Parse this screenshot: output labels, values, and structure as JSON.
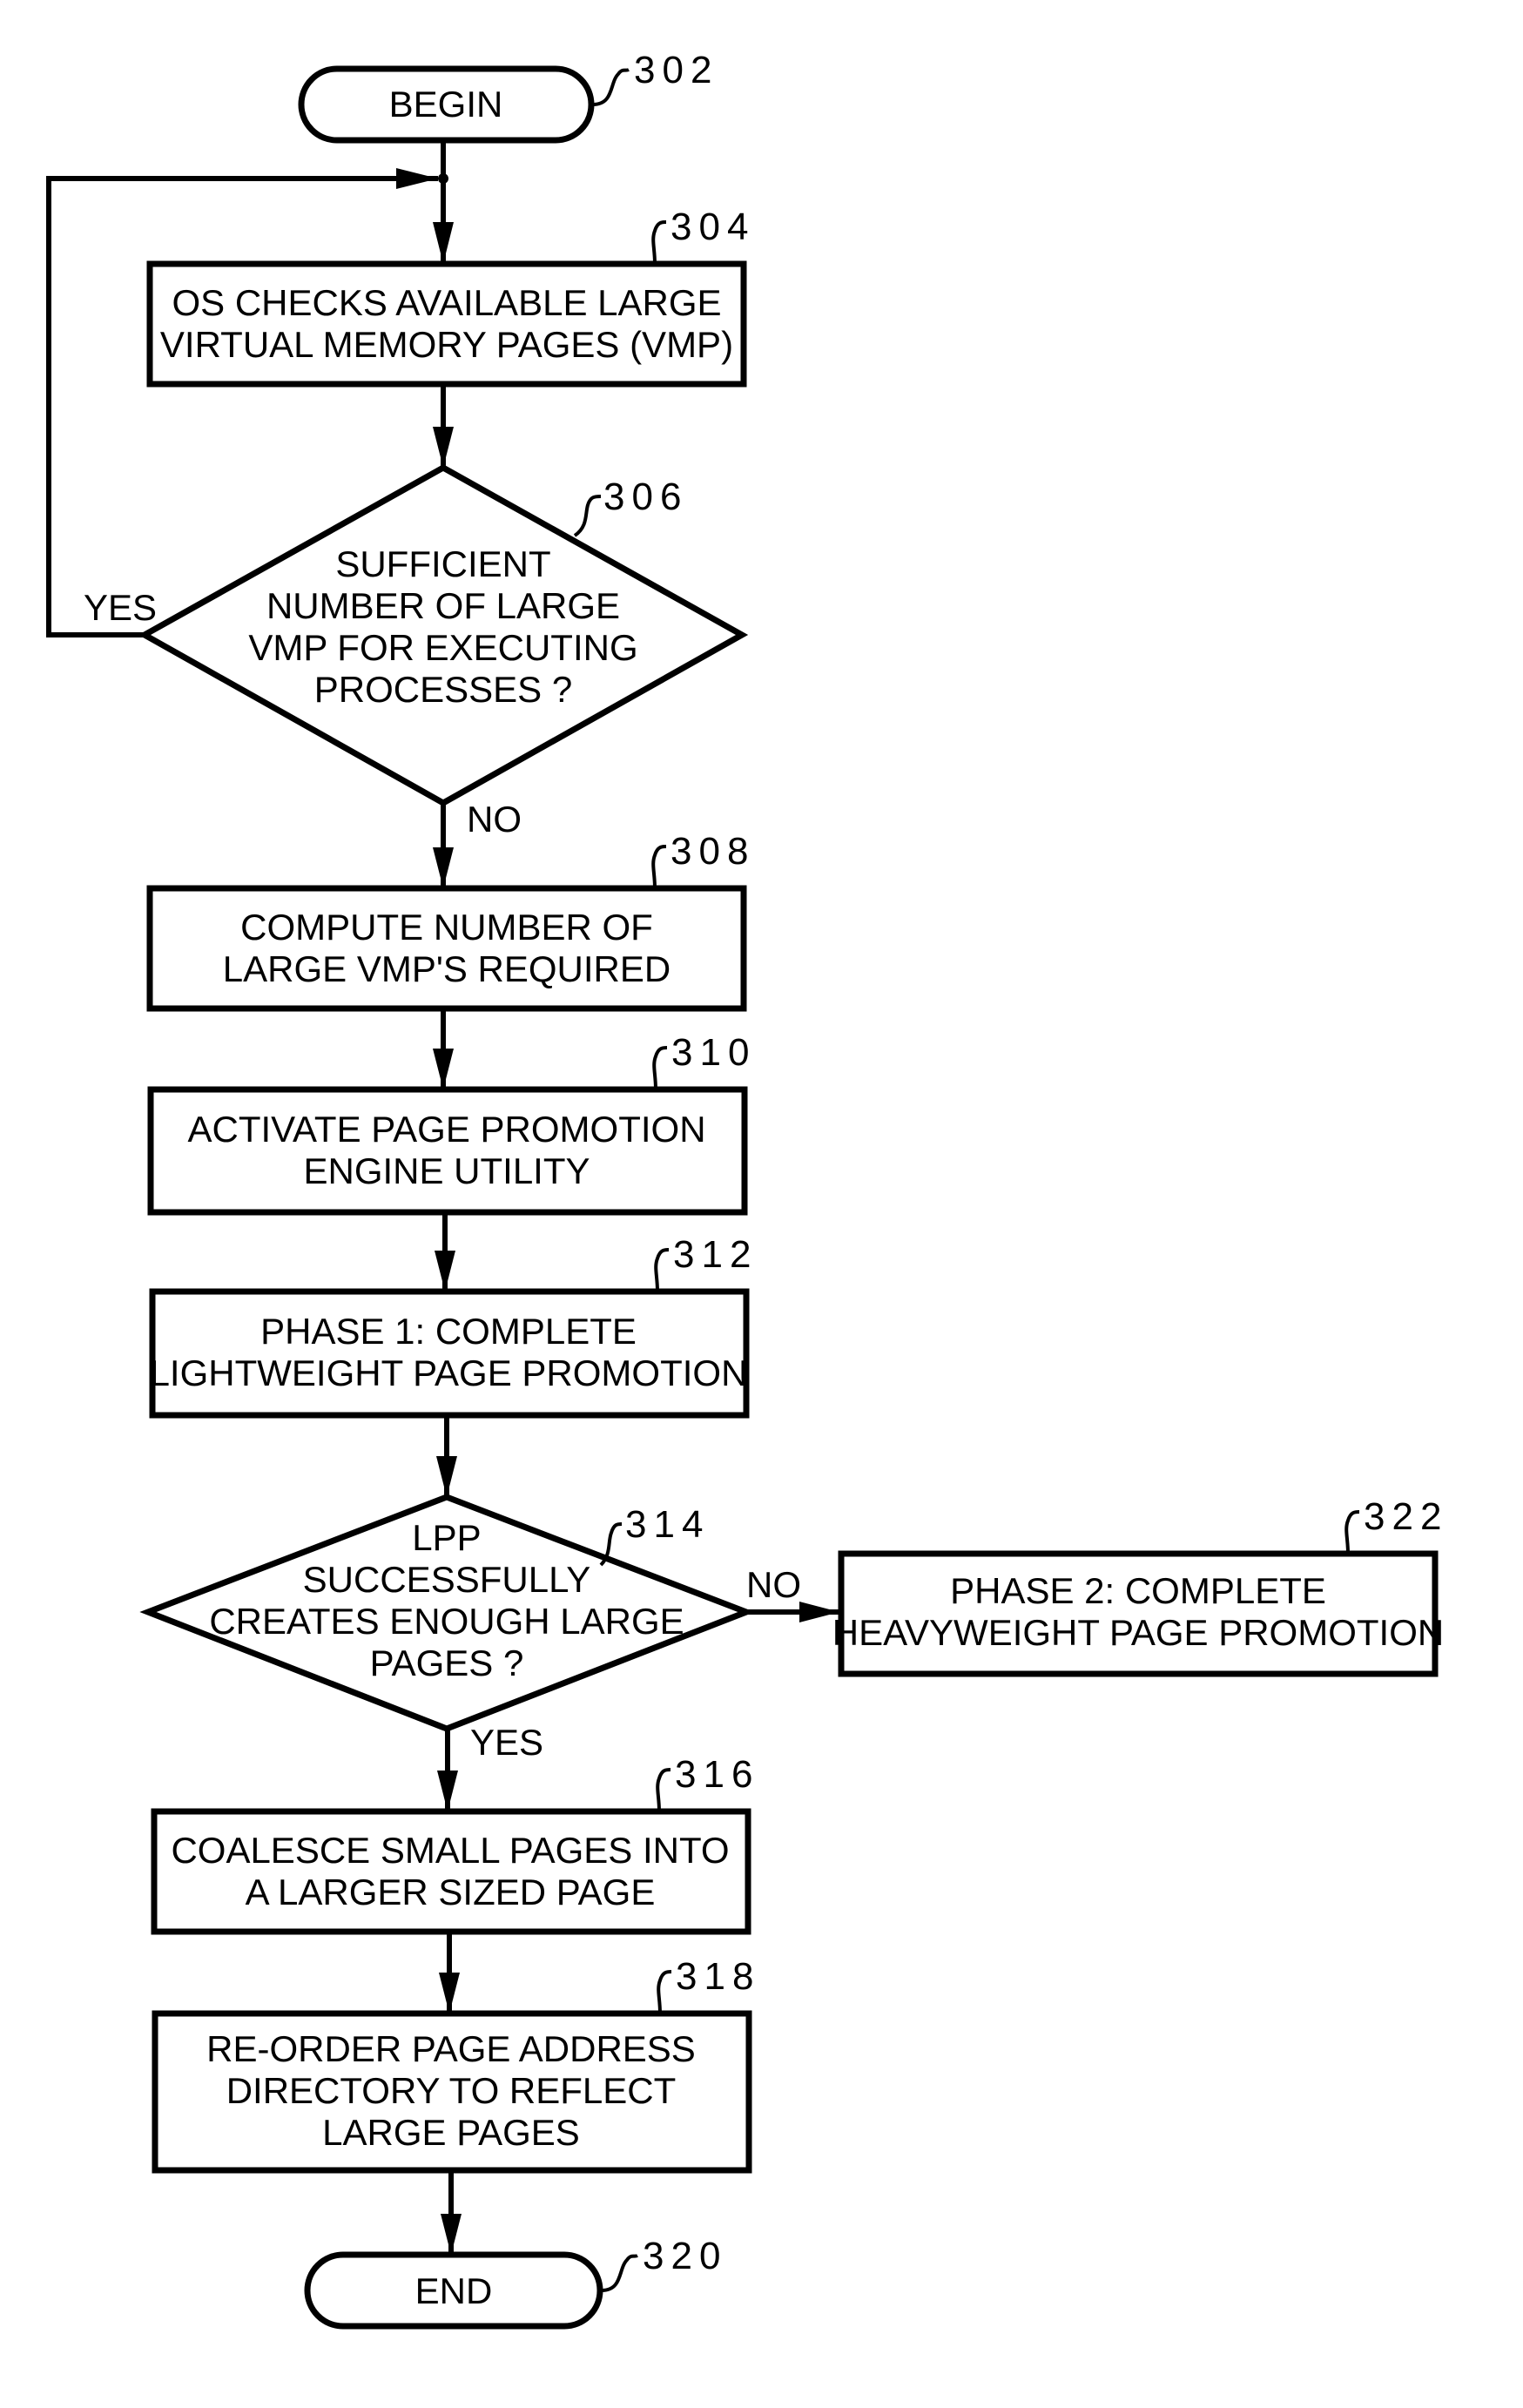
{
  "diagram": {
    "type": "flowchart",
    "nodes": {
      "begin": {
        "ref": "302",
        "shape": "terminal",
        "lines": [
          "BEGIN"
        ]
      },
      "check": {
        "ref": "304",
        "shape": "process",
        "lines": [
          "OS CHECKS AVAILABLE LARGE",
          "VIRTUAL MEMORY PAGES (VMP)"
        ]
      },
      "suff": {
        "ref": "306",
        "shape": "decision",
        "lines": [
          "SUFFICIENT",
          "NUMBER OF LARGE",
          "VMP FOR EXECUTING",
          "PROCESSES ?"
        ]
      },
      "compute": {
        "ref": "308",
        "shape": "process",
        "lines": [
          "COMPUTE NUMBER OF",
          "LARGE VMP'S REQUIRED"
        ]
      },
      "activate": {
        "ref": "310",
        "shape": "process",
        "lines": [
          "ACTIVATE PAGE PROMOTION",
          "ENGINE UTILITY"
        ]
      },
      "phase1": {
        "ref": "312",
        "shape": "process",
        "lines": [
          "PHASE 1: COMPLETE",
          "LIGHTWEIGHT PAGE PROMOTION"
        ]
      },
      "lpp": {
        "ref": "314",
        "shape": "decision",
        "lines": [
          "LPP",
          "SUCCESSFULLY",
          "CREATES ENOUGH LARGE",
          "PAGES ?"
        ]
      },
      "phase2": {
        "ref": "322",
        "shape": "process",
        "lines": [
          "PHASE 2: COMPLETE",
          "HEAVYWEIGHT PAGE PROMOTION"
        ]
      },
      "coalesce": {
        "ref": "316",
        "shape": "process",
        "lines": [
          "COALESCE SMALL PAGES INTO",
          "A LARGER SIZED PAGE"
        ]
      },
      "reorder": {
        "ref": "318",
        "shape": "process",
        "lines": [
          "RE-ORDER PAGE ADDRESS",
          "DIRECTORY TO REFLECT",
          "LARGE PAGES"
        ]
      },
      "end": {
        "ref": "320",
        "shape": "terminal",
        "lines": [
          "END"
        ]
      }
    },
    "edges": [
      {
        "from": "begin",
        "to": "check",
        "label": ""
      },
      {
        "from": "check",
        "to": "suff",
        "label": ""
      },
      {
        "from": "suff",
        "to": "check",
        "label": "YES"
      },
      {
        "from": "suff",
        "to": "compute",
        "label": "NO"
      },
      {
        "from": "compute",
        "to": "activate",
        "label": ""
      },
      {
        "from": "activate",
        "to": "phase1",
        "label": ""
      },
      {
        "from": "phase1",
        "to": "lpp",
        "label": ""
      },
      {
        "from": "lpp",
        "to": "phase2",
        "label": "NO"
      },
      {
        "from": "lpp",
        "to": "coalesce",
        "label": "YES"
      },
      {
        "from": "coalesce",
        "to": "reorder",
        "label": ""
      },
      {
        "from": "reorder",
        "to": "end",
        "label": ""
      }
    ],
    "labels": {
      "suff_yes": "YES",
      "suff_no": "NO",
      "lpp_no": "NO",
      "lpp_yes": "YES"
    }
  }
}
